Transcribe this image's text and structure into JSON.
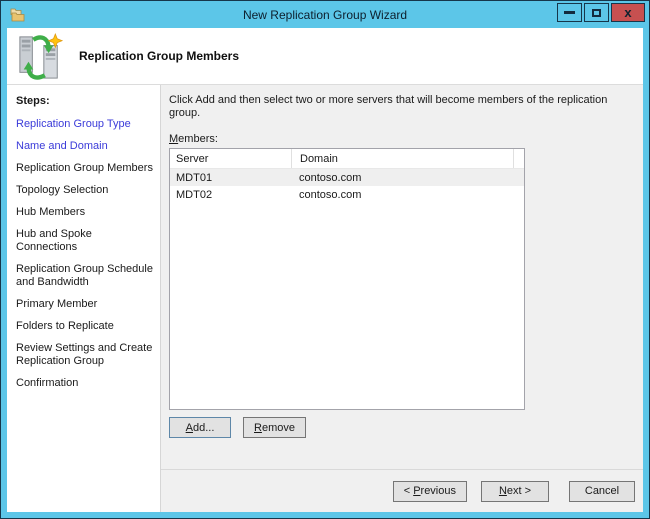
{
  "colors": {
    "titlebar_blue": "#5CC6E8",
    "frame_border": "#16364A",
    "close_red": "#C75050",
    "link_blue": "#3B3BD9",
    "selection_gray": "#EFEFEF",
    "content_bg": "#F0F0F0",
    "button_face": "#E2E2E2"
  },
  "window": {
    "title": "New Replication Group Wizard",
    "icon": "dfs-management-folders-icon",
    "controls": {
      "minimize_icon": "minimize-icon",
      "maximize_icon": "maximize-icon",
      "close_glyph": "x"
    }
  },
  "header": {
    "title": "Replication Group Members",
    "icon": "new-replication-group-servers-icon"
  },
  "sidebar": {
    "heading": "Steps:",
    "items": [
      {
        "label": "Replication Group Type",
        "state": "completed"
      },
      {
        "label": "Name and Domain",
        "state": "completed"
      },
      {
        "label": "Replication Group Members",
        "state": "current"
      },
      {
        "label": "Topology Selection",
        "state": "upcoming"
      },
      {
        "label": "Hub Members",
        "state": "upcoming"
      },
      {
        "label": "Hub and Spoke Connections",
        "state": "upcoming"
      },
      {
        "label": "Replication Group Schedule and Bandwidth",
        "state": "upcoming"
      },
      {
        "label": "Primary Member",
        "state": "upcoming"
      },
      {
        "label": "Folders to Replicate",
        "state": "upcoming"
      },
      {
        "label": "Review Settings and Create Replication Group",
        "state": "upcoming"
      },
      {
        "label": "Confirmation",
        "state": "upcoming"
      }
    ]
  },
  "content": {
    "instruction": "Click Add and then select two or more servers that will become members of the replication group.",
    "members_label": {
      "label": "Members:",
      "mnemonic": 0
    },
    "table": {
      "columns": [
        "Server",
        "Domain"
      ],
      "rows": [
        {
          "server": "MDT01",
          "domain": "contoso.com"
        },
        {
          "server": "MDT02",
          "domain": "contoso.com"
        }
      ],
      "selected_row_index": 0
    },
    "add_button": {
      "label": "Add...",
      "mnemonic": 0
    },
    "remove_button": {
      "label": "Remove",
      "mnemonic": 0
    }
  },
  "footer": {
    "previous": {
      "label": "< Previous",
      "mnemonic": 2
    },
    "next": {
      "label": "Next >",
      "mnemonic": 0
    },
    "cancel": {
      "label": "Cancel",
      "mnemonic": -1
    }
  }
}
